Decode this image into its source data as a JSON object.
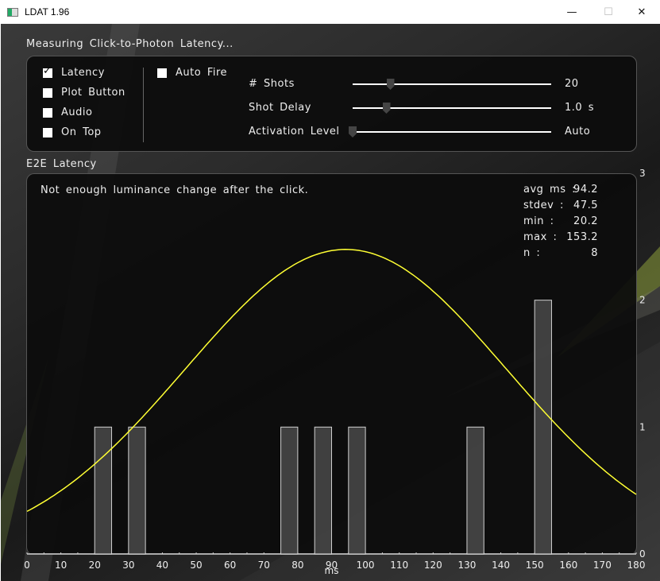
{
  "window": {
    "title": "LDAT 1.96",
    "minimize": "—",
    "maximize": "☐",
    "close": "✕"
  },
  "status": "Measuring Click-to-Photon Latency...",
  "options": [
    {
      "label": "Latency",
      "checked": true
    },
    {
      "label": "Plot Button",
      "checked": false
    },
    {
      "label": "Audio",
      "checked": false
    },
    {
      "label": "On Top",
      "checked": false
    }
  ],
  "auto_fire": {
    "label": "Auto Fire",
    "checked": false
  },
  "sliders": [
    {
      "label": "# Shots",
      "value": "20",
      "fraction": 0.19
    },
    {
      "label": "Shot Delay",
      "value": "1.0 s",
      "fraction": 0.17
    },
    {
      "label": "Activation Level",
      "value": "Auto",
      "fraction": 0.0
    }
  ],
  "chart_title": "E2E Latency",
  "message": "Not enough luminance change after the click.",
  "stats": [
    {
      "label": "avg ms :",
      "value": "94.2"
    },
    {
      "label": "stdev :",
      "value": "47.5"
    },
    {
      "label": "min :",
      "value": "20.2"
    },
    {
      "label": "max :",
      "value": "153.2"
    },
    {
      "label": "n :",
      "value": "8"
    }
  ],
  "colors": {
    "curve": "#ffff33",
    "bar_fill": "#4a4a4a",
    "bar_stroke": "#d0d0d0"
  },
  "chart_data": {
    "type": "bar",
    "title": "E2E Latency",
    "xlabel": "ms",
    "ylabel": "",
    "xlim": [
      0,
      180
    ],
    "ylim": [
      0,
      3
    ],
    "xticks": [
      "0",
      "10",
      "20",
      "30",
      "40",
      "50",
      "60",
      "70",
      "80",
      "90",
      "100",
      "110",
      "120",
      "130",
      "140",
      "150",
      "160",
      "170",
      "180"
    ],
    "yticks": [
      "0",
      "1",
      "2",
      "3"
    ],
    "bin_width": 5,
    "bins": [
      {
        "x": 20,
        "count": 1
      },
      {
        "x": 30,
        "count": 1
      },
      {
        "x": 75,
        "count": 1
      },
      {
        "x": 85,
        "count": 1
      },
      {
        "x": 95,
        "count": 1
      },
      {
        "x": 130,
        "count": 1
      },
      {
        "x": 150,
        "count": 2
      }
    ],
    "fit": {
      "type": "normal",
      "mean": 94.2,
      "stdev": 47.5,
      "peak": 2.4
    }
  }
}
